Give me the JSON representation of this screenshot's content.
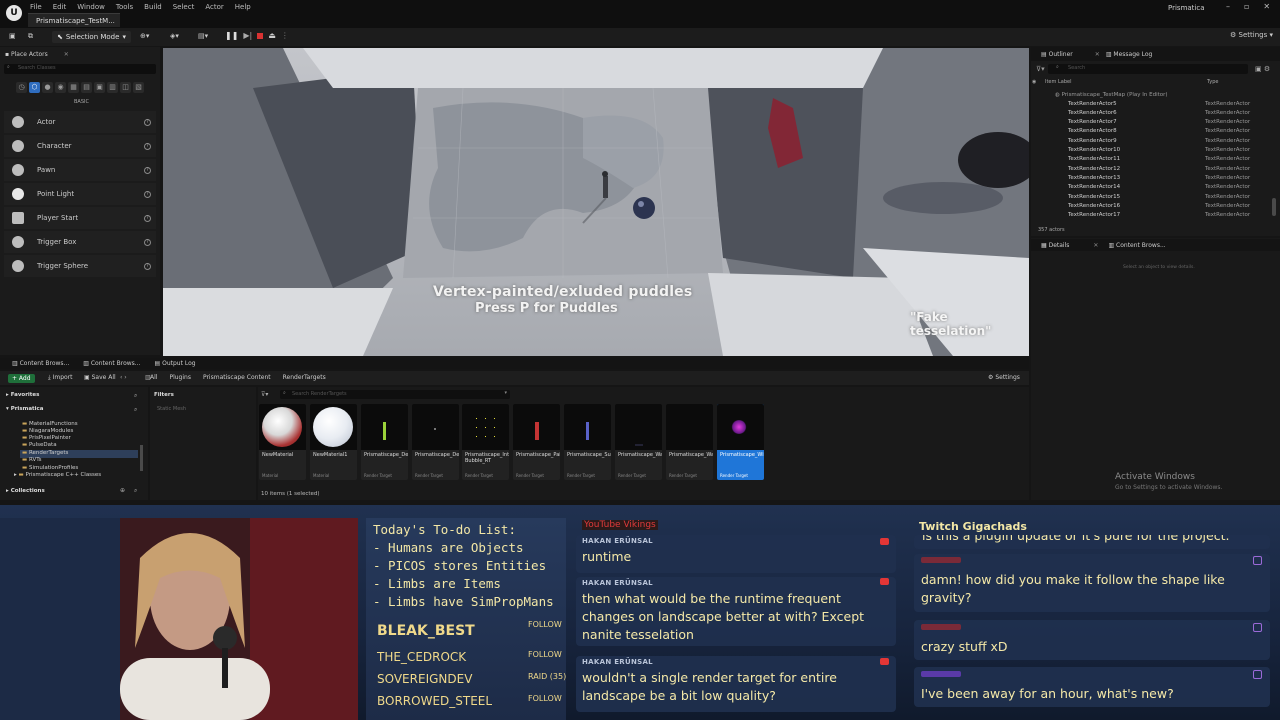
{
  "window": {
    "app_name": "Prismatica",
    "doc_tab": "Prismatiscape_TestM...",
    "menu": [
      "File",
      "Edit",
      "Window",
      "Tools",
      "Build",
      "Select",
      "Actor",
      "Help"
    ],
    "mode_label": "Selection Mode",
    "settings_label": "Settings"
  },
  "place_actors": {
    "tab": "Place Actors",
    "search_placeholder": "Search Classes",
    "category": "BASIC",
    "items": [
      "Actor",
      "Character",
      "Pawn",
      "Point Light",
      "Player Start",
      "Trigger Box",
      "Trigger Sphere"
    ]
  },
  "viewport": {
    "caption_line1": "Vertex-painted/exluded puddles",
    "caption_line2": "Press P for Puddles",
    "caption_right": "\"Fake tesselation\""
  },
  "outliner": {
    "tabs": [
      "Outliner",
      "Message Log"
    ],
    "search_placeholder": "Search",
    "col_label": "Item Label",
    "col_type": "Type",
    "root": "Prismatiscape_TestMap (Play In Editor)",
    "rows": [
      {
        "name": "TextRenderActor5",
        "type": "TextRenderActor"
      },
      {
        "name": "TextRenderActor6",
        "type": "TextRenderActor"
      },
      {
        "name": "TextRenderActor7",
        "type": "TextRenderActor"
      },
      {
        "name": "TextRenderActor8",
        "type": "TextRenderActor"
      },
      {
        "name": "TextRenderActor9",
        "type": "TextRenderActor"
      },
      {
        "name": "TextRenderActor10",
        "type": "TextRenderActor"
      },
      {
        "name": "TextRenderActor11",
        "type": "TextRenderActor"
      },
      {
        "name": "TextRenderActor12",
        "type": "TextRenderActor"
      },
      {
        "name": "TextRenderActor13",
        "type": "TextRenderActor"
      },
      {
        "name": "TextRenderActor14",
        "type": "TextRenderActor"
      },
      {
        "name": "TextRenderActor15",
        "type": "TextRenderActor"
      },
      {
        "name": "TextRenderActor16",
        "type": "TextRenderActor"
      },
      {
        "name": "TextRenderActor17",
        "type": "TextRenderActor"
      }
    ],
    "count": "357 actors"
  },
  "details": {
    "tabs": [
      "Details",
      "Content Brows..."
    ],
    "empty_text": "Select an object to view details."
  },
  "windows_watermark": {
    "line1": "Activate Windows",
    "line2": "Go to Settings to activate Windows."
  },
  "content_browser": {
    "tabs": [
      "Content Brows...",
      "Content Brows...",
      "Output Log"
    ],
    "toolbar": {
      "add": "+ Add",
      "import": "Import",
      "save_all": "Save All",
      "settings": "Settings"
    },
    "breadcrumb": [
      "All",
      "Plugins",
      "Prismatiscape Content",
      "RenderTargets"
    ],
    "tree_favorites": "Favorites",
    "tree_root": "Prismatica",
    "tree_items": [
      "MaterialFunctions",
      "NiagaraModules",
      "PrisPixelPainter",
      "PulseData",
      "RenderTargets",
      "RVTs",
      "SimulationProfiles",
      "Prismatiscape C++ Classes"
    ],
    "collections": "Collections",
    "filters_label": "Filters",
    "filter_item": "Static Mesh",
    "search_placeholder": "Search RenderTargets",
    "assets": [
      {
        "name": "NewMaterial",
        "type": "Material"
      },
      {
        "name": "NewMaterial1",
        "type": "Material"
      },
      {
        "name": "Prismatiscape_Deform_RT",
        "type": "Render Target"
      },
      {
        "name": "Prismatiscape_DeformInput_RT",
        "type": "Render Target"
      },
      {
        "name": "Prismatiscape_Interaction Bubble_RT",
        "type": "Render Target"
      },
      {
        "name": "Prismatiscape_Paint_RT",
        "type": "Render Target"
      },
      {
        "name": "Prismatiscape_Surface_RT",
        "type": "Render Target"
      },
      {
        "name": "Prismatiscape_Water_RT",
        "type": "Render Target"
      },
      {
        "name": "Prismatiscape_WaterVelocity_RT",
        "type": "Render Target"
      },
      {
        "name": "Prismatiscape_Wind_RT",
        "type": "Render Target"
      }
    ],
    "status": "10 items (1 selected)"
  },
  "stream": {
    "todo_title": "Today's To-do List:",
    "todo_items": [
      "- Humans are Objects",
      "- PICOS stores Entities",
      "- Limbs are Items",
      "- Limbs have SimPropMans"
    ],
    "followers": [
      {
        "name": "BLEAK_BEST",
        "tag": "FOLLOW"
      },
      {
        "name": "THE_CEDROCK",
        "tag": "FOLLOW"
      },
      {
        "name": "SOVEREIGNDEV",
        "tag": "RAID (35)"
      },
      {
        "name": "BORROWED_STEEL",
        "tag": "FOLLOW"
      }
    ],
    "youtube_label": "YouTube Vikings",
    "youtube_messages": [
      {
        "user": "HAKAN ERÜNSAL",
        "text": "runtime"
      },
      {
        "user": "HAKAN ERÜNSAL",
        "text": "then what would be the runtime frequent changes on landscape better at with? Except nanite tesselation"
      },
      {
        "user": "HAKAN ERÜNSAL",
        "text": "wouldn't a single render target for entire landscape be a bit low quality?"
      }
    ],
    "twitch_label": "Twitch Gigachads",
    "twitch_messages": [
      {
        "user": "",
        "text": "is this a plugin update or it's pure for the project."
      },
      {
        "user": "",
        "text": "damn! how did you make it follow the shape like gravity?"
      },
      {
        "user": "",
        "text": "crazy stuff xD"
      },
      {
        "user": "",
        "text": "I've been away for an hour, what's new?"
      }
    ]
  }
}
